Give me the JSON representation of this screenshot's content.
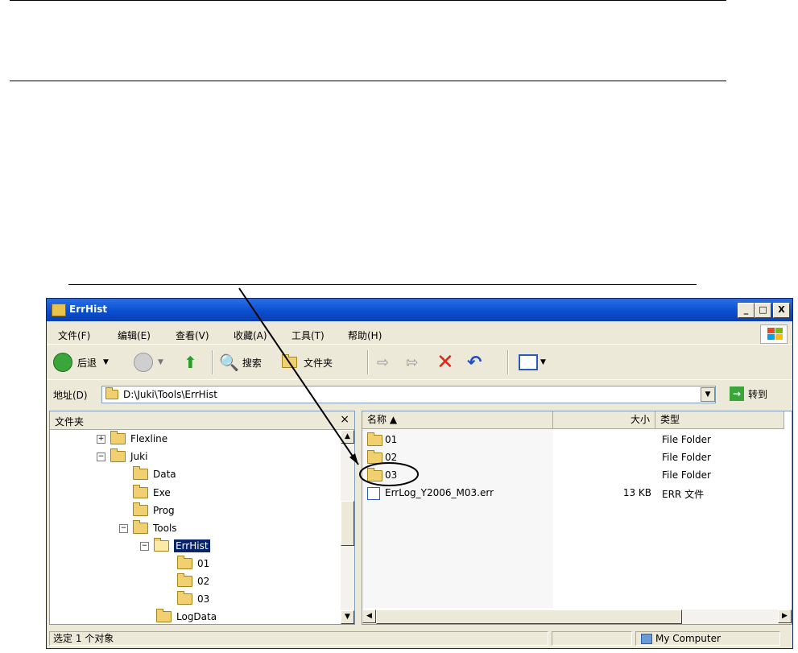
{
  "window": {
    "title": "ErrHist",
    "controls": {
      "minimize": "_",
      "maximize": "□",
      "close": "X"
    }
  },
  "menu": [
    "文件(F)",
    "编辑(E)",
    "查看(V)",
    "收藏(A)",
    "工具(T)",
    "帮助(H)"
  ],
  "toolbar": {
    "back_label": "后退",
    "search_label": "搜索",
    "folders_label": "文件夹"
  },
  "address": {
    "label": "地址(D)",
    "value": "D:\\Juki\\Tools\\ErrHist",
    "go_label": "转到"
  },
  "folders_pane": {
    "title": "文件夹",
    "close": "×",
    "tree": [
      {
        "label": "Flexline",
        "expander": "+",
        "selected": false
      },
      {
        "label": "Juki",
        "expander": "−",
        "selected": false
      },
      {
        "label": "Data",
        "expander": "",
        "selected": false
      },
      {
        "label": "Exe",
        "expander": "",
        "selected": false
      },
      {
        "label": "Prog",
        "expander": "",
        "selected": false
      },
      {
        "label": "Tools",
        "expander": "−",
        "selected": false
      },
      {
        "label": "ErrHist",
        "expander": "−",
        "selected": true
      },
      {
        "label": "01",
        "expander": "",
        "selected": false
      },
      {
        "label": "02",
        "expander": "",
        "selected": false
      },
      {
        "label": "03",
        "expander": "",
        "selected": false
      },
      {
        "label": "LogData",
        "expander": "",
        "selected": false
      }
    ]
  },
  "file_list": {
    "columns": [
      "名称 ▲",
      "大小",
      "类型"
    ],
    "rows": [
      {
        "name": "01",
        "size": "",
        "type": "File Folder"
      },
      {
        "name": "02",
        "size": "",
        "type": "File Folder"
      },
      {
        "name": "03",
        "size": "",
        "type": "File Folder"
      },
      {
        "name": "ErrLog_Y2006_M03.err",
        "size": "13 KB",
        "type": "ERR 文件"
      }
    ]
  },
  "status": {
    "text": "选定 1 个对象",
    "zone": "My Computer"
  },
  "colors": {
    "title_blue": "#0a4fcf",
    "chrome": "#ece9d8",
    "selection": "#0a246a",
    "folder_yellow": "#f0d070"
  }
}
